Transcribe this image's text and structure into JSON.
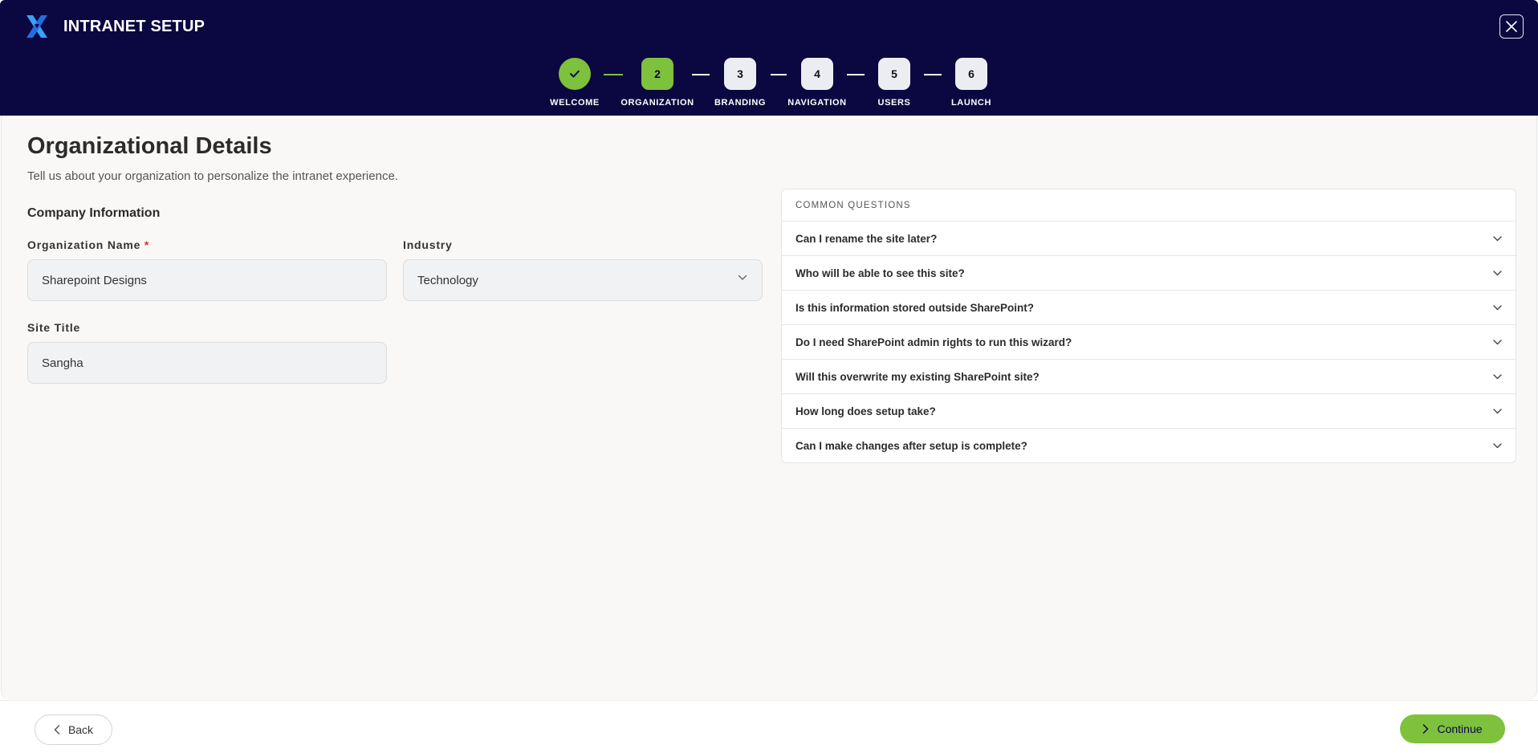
{
  "header": {
    "title": "INTRANET SETUP",
    "steps": [
      {
        "badge": "",
        "label": "WELCOME",
        "state": "done"
      },
      {
        "badge": "2",
        "label": "ORGANIZATION",
        "state": "active"
      },
      {
        "badge": "3",
        "label": "BRANDING",
        "state": "pending"
      },
      {
        "badge": "4",
        "label": "NAVIGATION",
        "state": "pending"
      },
      {
        "badge": "5",
        "label": "USERS",
        "state": "pending"
      },
      {
        "badge": "6",
        "label": "LAUNCH",
        "state": "pending"
      }
    ]
  },
  "main": {
    "title": "Organizational Details",
    "subtitle": "Tell us about your organization to personalize the intranet experience.",
    "section_title": "Company Information",
    "org_name": {
      "label": "Organization Name",
      "required_mark": "*",
      "value": "Sharepoint Designs"
    },
    "industry": {
      "label": "Industry",
      "value": "Technology"
    },
    "site_title": {
      "label": "Site Title",
      "value": "Sangha"
    }
  },
  "faq": {
    "heading": "COMMON QUESTIONS",
    "items": [
      "Can I rename the site later?",
      "Who will be able to see this site?",
      "Is this information stored outside SharePoint?",
      "Do I need SharePoint admin rights to run this wizard?",
      "Will this overwrite my existing SharePoint site?",
      "How long does setup take?",
      "Can I make changes after setup is complete?"
    ]
  },
  "footer": {
    "back_label": "Back",
    "continue_label": "Continue"
  },
  "colors": {
    "header_bg": "#0b0740",
    "accent": "#7ec13c",
    "required": "#d9342b"
  }
}
